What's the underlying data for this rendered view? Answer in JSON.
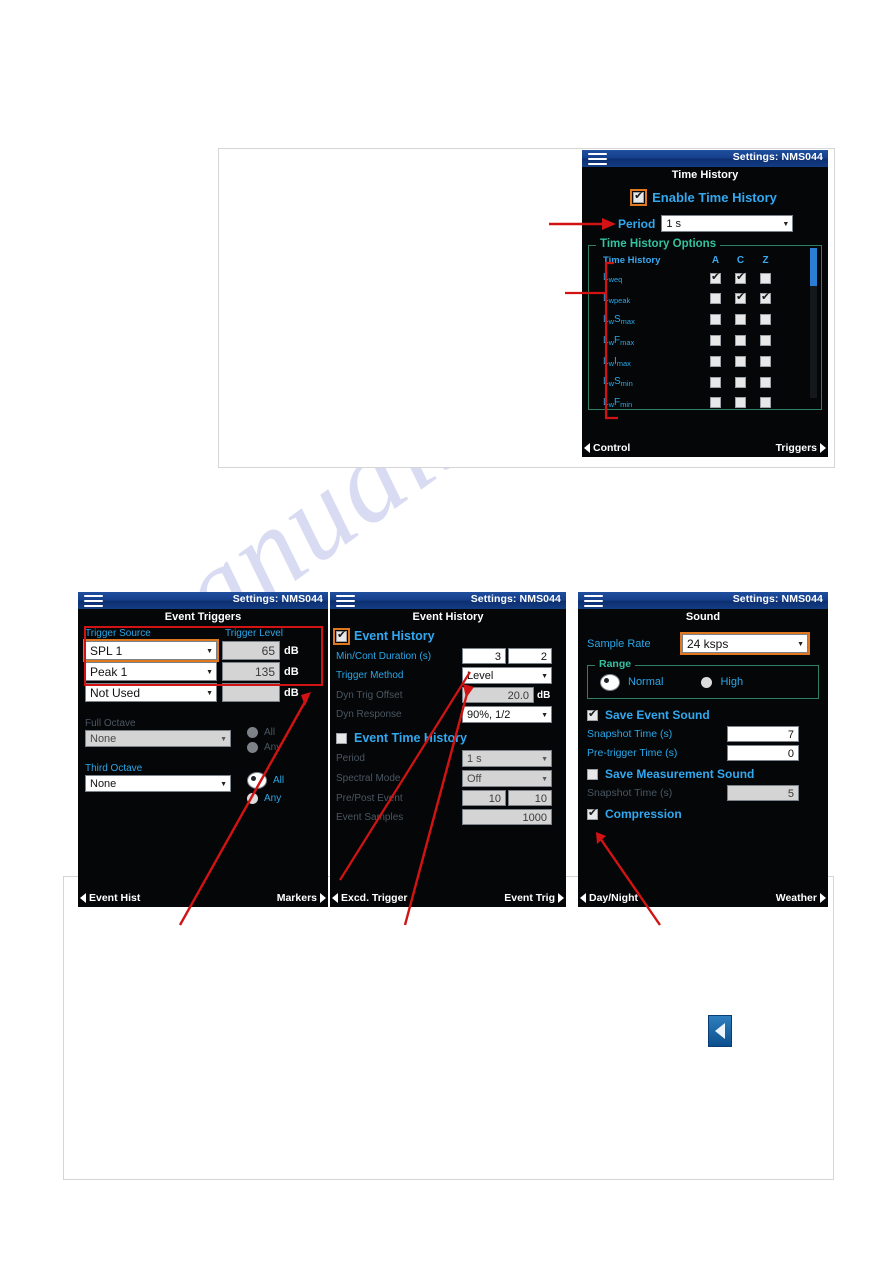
{
  "watermark": {
    "text": "manualsive.com"
  },
  "time_history_panel": {
    "device_id": "Settings: NMS044",
    "screen_title": "Time History",
    "enable_label": "Enable Time History",
    "enable_checked": true,
    "period_label": "Period",
    "period_value": "1 s",
    "options_group_title": "Time History Options",
    "column_header_label": "Time History",
    "columns": [
      "A",
      "C",
      "Z"
    ],
    "rows": [
      {
        "base": "L",
        "sub": "weq",
        "checks": [
          true,
          true,
          false
        ]
      },
      {
        "base": "L",
        "sub": "wpeak",
        "checks": [
          false,
          true,
          true
        ]
      },
      {
        "base": "L",
        "sub2": "w",
        "mid": "S",
        "sub3": "max",
        "checks": [
          false,
          false,
          false
        ]
      },
      {
        "base": "L",
        "sub2": "w",
        "mid": "F",
        "sub3": "max",
        "checks": [
          false,
          false,
          false
        ]
      },
      {
        "base": "L",
        "sub2": "w",
        "mid": "I",
        "sub3": "max",
        "checks": [
          false,
          false,
          false
        ]
      },
      {
        "base": "L",
        "sub2": "w",
        "mid": "S",
        "sub3": "min",
        "checks": [
          false,
          false,
          false
        ]
      },
      {
        "base": "L",
        "sub2": "w",
        "mid": "F",
        "sub3": "min",
        "checks": [
          false,
          false,
          false
        ]
      }
    ],
    "nav_left": "Control",
    "nav_right": "Triggers"
  },
  "event_triggers_panel": {
    "device_id": "Settings: NMS044",
    "screen_title": "Event Triggers",
    "col_source_label": "Trigger Source",
    "col_level_label": "Trigger Level",
    "unit": "dB",
    "trigger_rows": [
      {
        "source": "SPL 1",
        "level": "65",
        "highlight": true
      },
      {
        "source": "Peak 1",
        "level": "135",
        "highlight": false
      },
      {
        "source": "Not Used",
        "level": "",
        "highlight": false
      }
    ],
    "full_octave_label": "Full Octave",
    "full_octave_value": "None",
    "full_octave_all": "All",
    "full_octave_any": "Any",
    "full_octave_selected": "",
    "third_octave_label": "Third Octave",
    "third_octave_value": "None",
    "third_octave_all": "All",
    "third_octave_any": "Any",
    "third_octave_selected": "All",
    "nav_left": "Event Hist",
    "nav_right": "Markers"
  },
  "event_history_panel": {
    "device_id": "Settings: NMS044",
    "screen_title": "Event History",
    "event_history_label": "Event History",
    "event_history_checked": true,
    "min_cont_label": "Min/Cont Duration (s)",
    "min_cont_value_1": "3",
    "min_cont_value_2": "2",
    "trigger_method_label": "Trigger Method",
    "trigger_method_value": "Level",
    "dyn_trig_offset_label": "Dyn Trig Offset",
    "dyn_trig_offset_value": "20.0",
    "dyn_trig_offset_unit": "dB",
    "dyn_response_label": "Dyn Response",
    "dyn_response_value": "90%, 1/2",
    "event_time_history_label": "Event Time History",
    "event_time_history_checked": false,
    "period_label": "Period",
    "period_value": "1 s",
    "spectral_mode_label": "Spectral Mode",
    "spectral_mode_value": "Off",
    "pre_post_label": "Pre/Post Event",
    "pre_post_value_1": "10",
    "pre_post_value_2": "10",
    "event_samples_label": "Event Samples",
    "event_samples_value": "1000",
    "nav_left": "Excd. Trigger",
    "nav_right": "Event Trig"
  },
  "sound_panel": {
    "device_id": "Settings: NMS044",
    "screen_title": "Sound",
    "sample_rate_label": "Sample Rate",
    "sample_rate_value": "24 ksps",
    "range_group_title": "Range",
    "range_normal_label": "Normal",
    "range_high_label": "High",
    "range_selected": "Normal",
    "save_event_sound_label": "Save Event Sound",
    "save_event_sound_checked": true,
    "snapshot_time_label": "Snapshot Time (s)",
    "snapshot_time_value": "7",
    "pretrigger_time_label": "Pre-trigger Time (s)",
    "pretrigger_time_value": "0",
    "save_measurement_sound_label": "Save Measurement Sound",
    "save_measurement_sound_checked": false,
    "snapshot_time_2_label": "Snapshot Time (s)",
    "snapshot_time_2_value": "5",
    "compression_label": "Compression",
    "compression_checked": true,
    "nav_left": "Day/Night",
    "nav_right": "Weather"
  },
  "colors": {
    "annotation_red": "#d31313",
    "highlight_orange": "#e07820",
    "label_cyan": "#2aa7e8",
    "group_green": "#33c2a0",
    "titlebar_blue": "#16408c"
  }
}
